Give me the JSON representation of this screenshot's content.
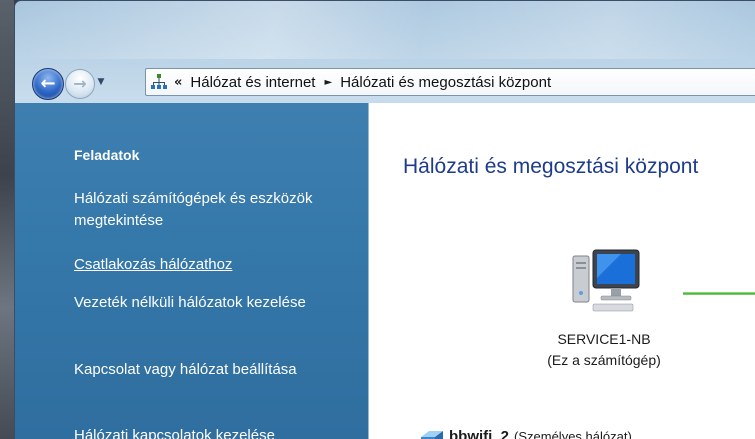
{
  "navigation": {
    "back_label": "",
    "forward_label": "",
    "breadcrumb_overflow": "«",
    "breadcrumbs": [
      {
        "label": "Hálózat és internet"
      },
      {
        "label": "Hálózati és megosztási központ"
      }
    ],
    "separator": "►"
  },
  "tasks": {
    "header": "Feladatok",
    "items": [
      {
        "label": "Hálózati számítógépek és eszközök megtekintése"
      },
      {
        "label": "Csatlakozás hálózathoz"
      },
      {
        "label": "Vezeték nélküli hálózatok kezelése"
      },
      {
        "label": "Kapcsolat vagy hálózat beállítása"
      },
      {
        "label": "Hálózati kapcsolatok kezelése"
      }
    ]
  },
  "main": {
    "title": "Hálózati és megosztási központ",
    "computer_name": "SERVICE1-NB",
    "computer_subtitle": "(Ez a számítógép)",
    "network_name": "bbwifi_2",
    "network_type": "(Személyes hálózat)"
  },
  "colors": {
    "task_pane": "#3578aa",
    "title_blue": "#1e3c8c",
    "connection_green": "#3bb02a"
  },
  "icons": {
    "back": "arrow-left-icon",
    "forward": "arrow-right-icon",
    "address": "network-icon",
    "computer": "computer-icon",
    "network": "network-location-icon"
  }
}
